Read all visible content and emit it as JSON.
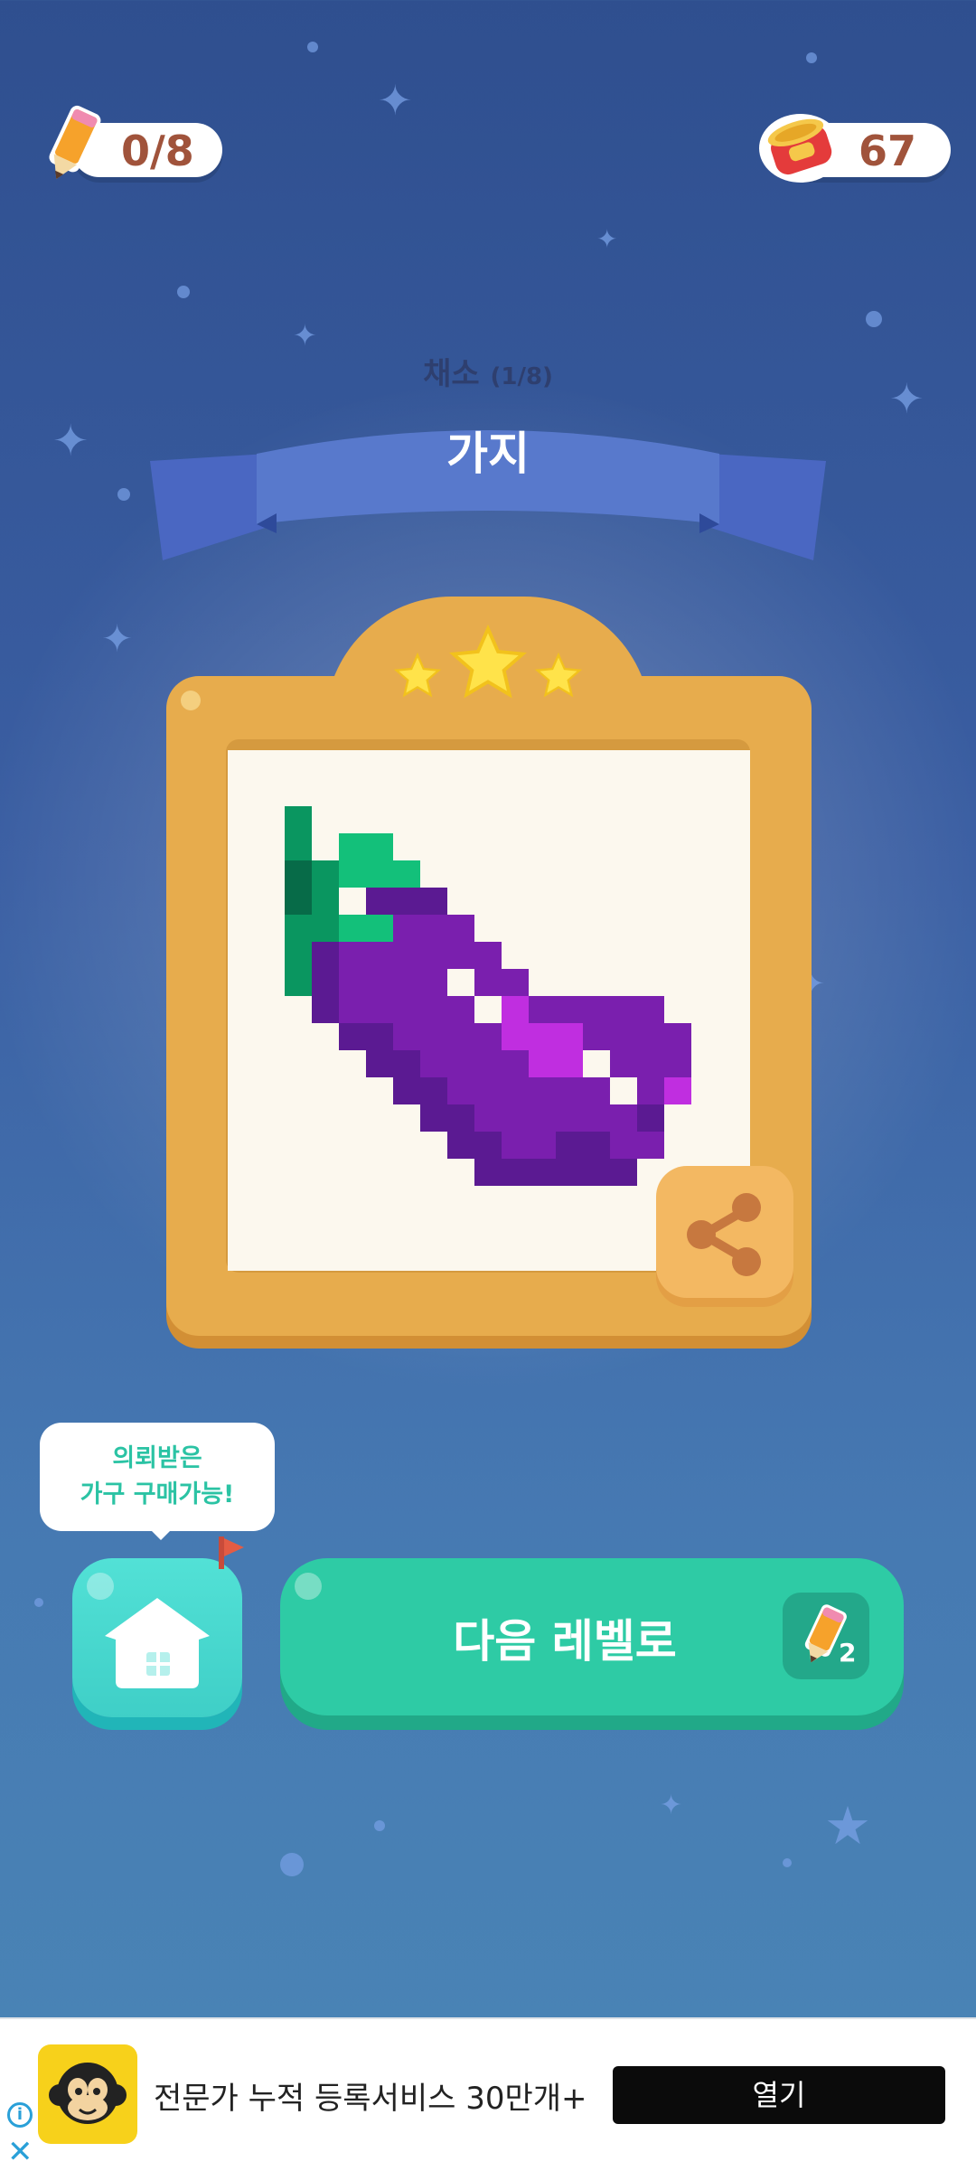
{
  "status": {
    "pencils": "0/8",
    "cans": "67"
  },
  "level": {
    "category": "채소",
    "progress": "(1/8)",
    "title": "가지",
    "stars_earned": 3
  },
  "tooltip": {
    "line1": "의뢰받은",
    "line2": "가구 구매가능!"
  },
  "buttons": {
    "next_label": "다음 레벨로",
    "next_cost": "2"
  },
  "ad": {
    "text": "전문가 누적 등록서비스 30만개+",
    "open_label": "열기"
  },
  "icons": {
    "pencil": "pencil-icon",
    "can": "can-icon",
    "share": "share-icon",
    "home": "home-icon",
    "info": "info-icon",
    "close": "close-icon"
  },
  "colors": {
    "frame": "#e7ac4d",
    "next_button": "#2ecba5",
    "home_button": "#3fcfc7",
    "eggplant": "#7a1fae"
  }
}
